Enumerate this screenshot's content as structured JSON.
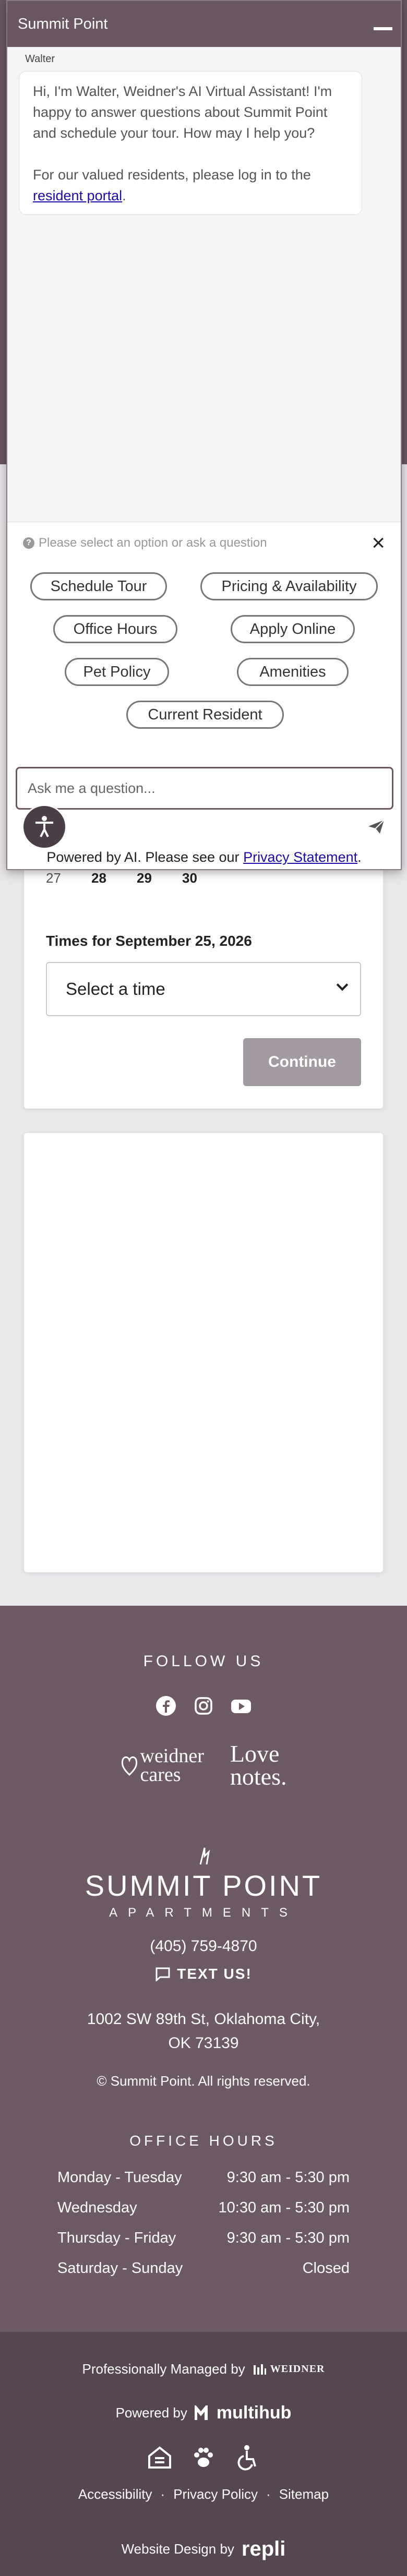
{
  "chat": {
    "title": "Summit Point",
    "bot_name": "Walter",
    "greeting": "Hi, I'm Walter, Weidner's AI Virtual Assistant! I'm happy to answer questions about Summit Point and schedule your tour. How may I help you?",
    "residents_text": "For our valued residents, please log in to the",
    "residents_link": "resident portal",
    "residents_end": ".",
    "options_hint": "Please select an option or ask a question",
    "options": [
      "Schedule Tour",
      "Pricing & Availability",
      "Office Hours",
      "Apply Online",
      "Pet Policy",
      "Amenities",
      "Current Resident"
    ],
    "input_placeholder": "Ask me a question...",
    "powered_text": "Powered by AI. Please see our",
    "privacy_link": "Privacy Statement",
    "powered_end": "."
  },
  "booking": {
    "calendar_days": [
      "27",
      "28",
      "29",
      "30"
    ],
    "times_label": "Times for September 25, 2026",
    "time_select": "Select a time",
    "continue": "Continue"
  },
  "footer": {
    "follow_us": "FOLLOW US",
    "brand1_line1": "weidner",
    "brand1_line2": "cares",
    "brand2_line1": "Love",
    "brand2_line2": "notes.",
    "logo_big": "SUMMIT POINT",
    "logo_small": "APARTMENTS",
    "phone": "(405) 759-4870",
    "text_us": "TEXT US!",
    "address_line1": "1002 SW 89th St, Oklahoma City,",
    "address_line2": "OK 73139",
    "copyright": "© Summit Point. All rights reserved.",
    "office_hours_title": "OFFICE HOURS",
    "office_hours": [
      {
        "day": "Monday - Tuesday",
        "hours": "9:30 am - 5:30 pm"
      },
      {
        "day": "Wednesday",
        "hours": "10:30 am - 5:30 pm"
      },
      {
        "day": "Thursday - Friday",
        "hours": "9:30 am - 5:30 pm"
      },
      {
        "day": "Saturday - Sunday",
        "hours": "Closed"
      }
    ],
    "managed_by": "Professionally Managed by",
    "managed_logo": "WEIDNER",
    "powered_by": "Powered by",
    "powered_logo": "multihub",
    "links": [
      "Accessibility",
      "Privacy Policy",
      "Sitemap"
    ],
    "website_design": "Website Design by",
    "design_logo": "repli"
  },
  "colors": {
    "brand": "#6b5762",
    "footer": "#6e5a64",
    "footer_bottom": "#554650",
    "button_disabled": "#a39aa1"
  }
}
